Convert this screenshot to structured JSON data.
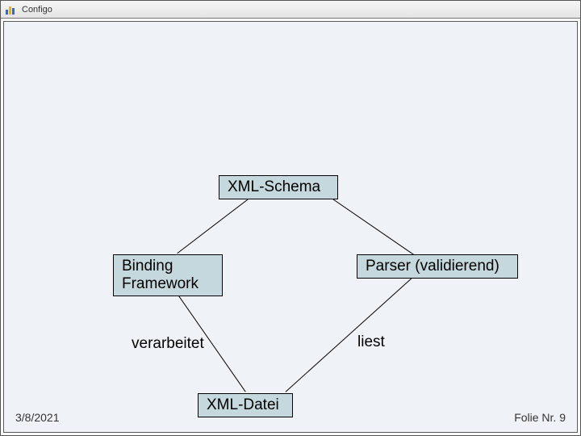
{
  "header": {
    "title": "Configo"
  },
  "diagram": {
    "nodes": {
      "xml_schema": "XML-Schema",
      "binding_framework": "Binding\nFramework",
      "parser": "Parser (validierend)",
      "xml_datei": "XML-Datei"
    },
    "edge_labels": {
      "verarbeitet": "verarbeitet",
      "liest": "liest"
    }
  },
  "footer": {
    "date": "3/8/2021",
    "page_label": "Folie Nr. 9"
  }
}
